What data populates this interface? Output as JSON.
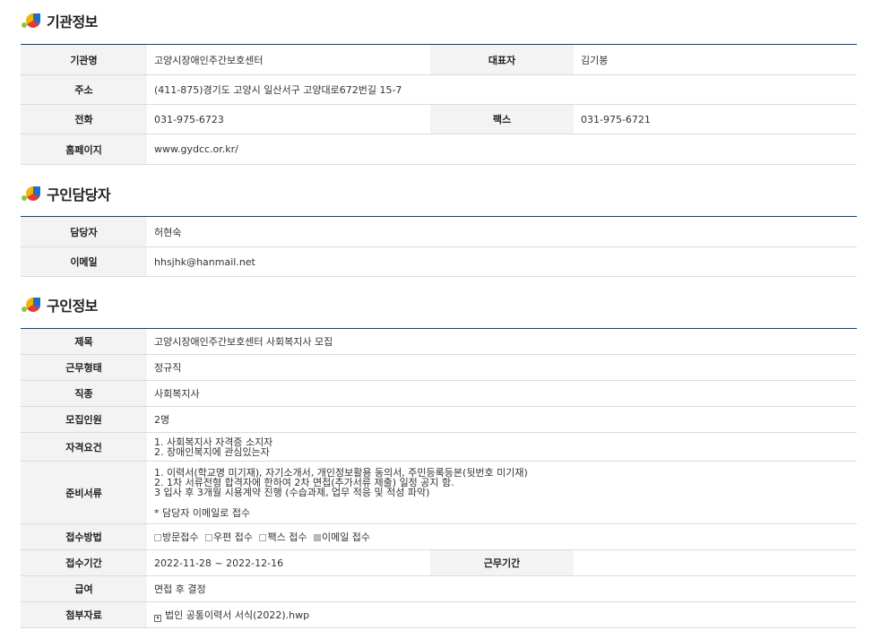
{
  "org": {
    "title": "기관정보",
    "name_label": "기관명",
    "name": "고양시장애인주간보호센터",
    "rep_label": "대표자",
    "rep": "김기봉",
    "addr_label": "주소",
    "addr": "(411-875)경기도 고양시 일산서구 고양대로672번길 15-7",
    "phone_label": "전화",
    "phone": "031-975-6723",
    "fax_label": "팩스",
    "fax": "031-975-6721",
    "home_label": "홈페이지",
    "home": "www.gydcc.or.kr/"
  },
  "contact": {
    "title": "구인담당자",
    "person_label": "담당자",
    "person": "허현숙",
    "email_label": "이메일",
    "email": "hhsjhk@hanmail.net"
  },
  "job": {
    "title": "구인정보",
    "subject_label": "제목",
    "subject": "고양시장애인주간보호센터 사회복지사 모집",
    "type_label": "근무형태",
    "type": "정규직",
    "category_label": "직종",
    "category": "사회복지사",
    "count_label": "모집인원",
    "count": "2명",
    "qual_label": "자격요건",
    "qual": [
      "1. 사회복지사 자격증 소지자",
      "2. 장애인복지에 관심있는자"
    ],
    "docs_label": "준비서류",
    "docs": [
      "1. 이력서(학교명 미기재), 자기소개서, 개인정보활용 동의서, 주민등록등본(뒷번호 미기재)",
      "2. 1차 서류전형 합격자에 한하여 2차 면접(추가서류 제출) 일정 공지 함.",
      "3  입사 후 3개월 시용계약 진행 (수습과제, 업무 적응 및 적성 파악)"
    ],
    "docs_note": "* 담당자 이메일로 접수",
    "method_label": "접수방법",
    "methods": [
      {
        "label": "방문접수",
        "checked": false
      },
      {
        "label": "우편 접수",
        "checked": false
      },
      {
        "label": "팩스 접수",
        "checked": false
      },
      {
        "label": "이메일 접수",
        "checked": true
      }
    ],
    "period_label": "접수기간",
    "period": "2022-11-28 ~ 2022-12-16",
    "workperiod_label": "근무기간",
    "workperiod": "",
    "salary_label": "급여",
    "salary": "면접 후 결정",
    "attach_label": "첨부자료",
    "attach": "법인 공통이력서 서식(2022).hwp"
  }
}
